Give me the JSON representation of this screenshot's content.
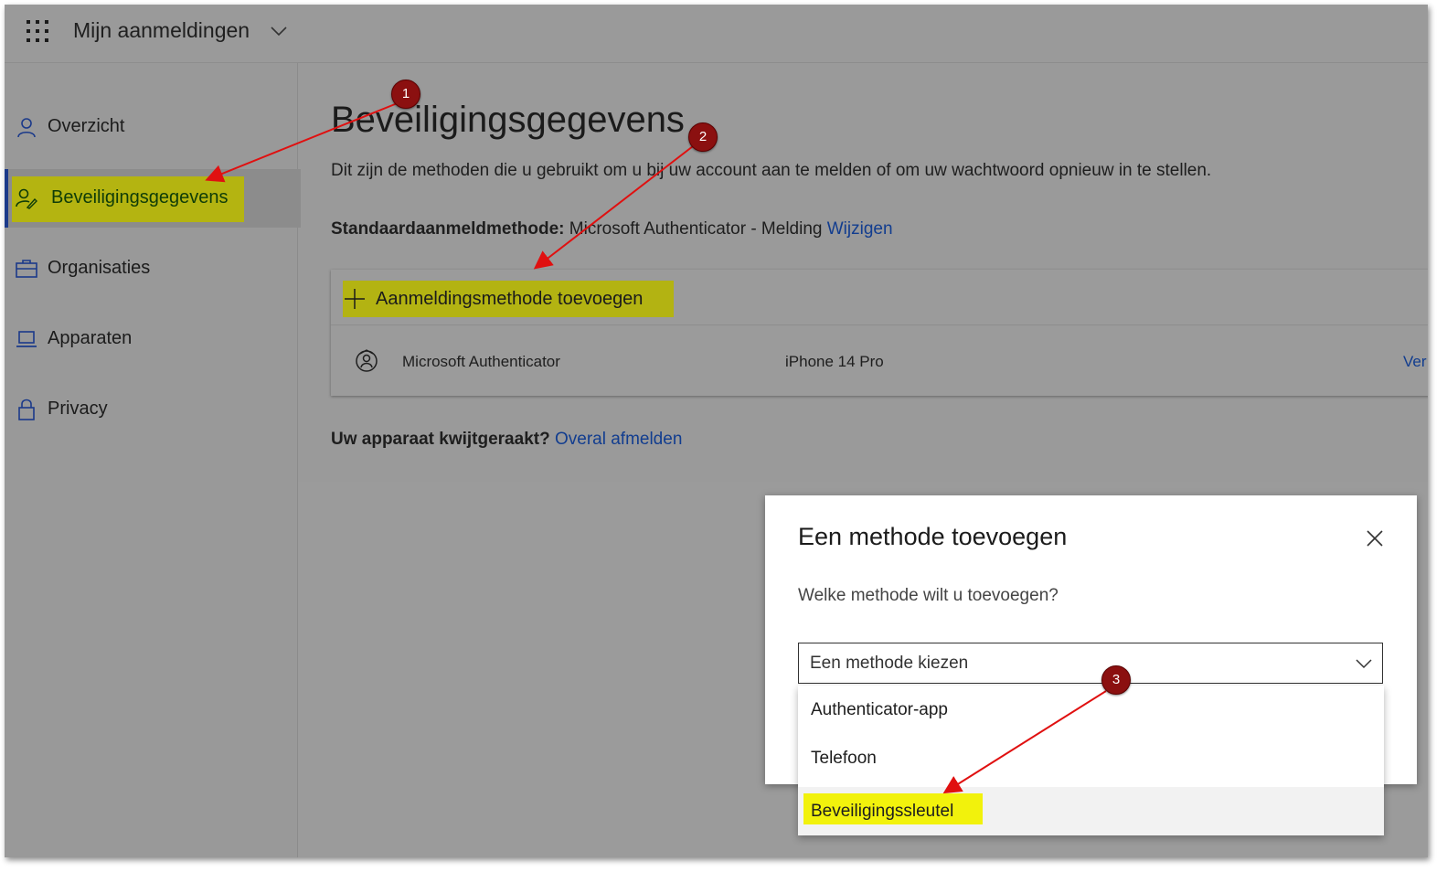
{
  "topbar": {
    "title": "Mijn aanmeldingen"
  },
  "sidebar": {
    "items": [
      {
        "label": "Overzicht",
        "icon": "person-icon"
      },
      {
        "label": "Beveiligingsgegevens",
        "icon": "security-info-icon",
        "active": true
      },
      {
        "label": "Organisaties",
        "icon": "briefcase-icon"
      },
      {
        "label": "Apparaten",
        "icon": "laptop-icon"
      },
      {
        "label": "Privacy",
        "icon": "lock-icon"
      }
    ]
  },
  "main": {
    "title": "Beveiligingsgegevens",
    "description": "Dit zijn de methoden die u gebruikt om u bij uw account aan te melden of om uw wachtwoord opnieuw in te stellen.",
    "default_method": {
      "label": "Standaardaanmeldmethode:",
      "value": "Microsoft Authenticator - Melding",
      "change_link": "Wijzigen"
    },
    "add_method_label": "Aanmeldingsmethode toevoegen",
    "methods": [
      {
        "name": "Microsoft Authenticator",
        "device": "iPhone 14 Pro",
        "action": "Ver"
      }
    ],
    "lost_device": {
      "label": "Uw apparaat kwijtgeraakt?",
      "link": "Overal afmelden"
    }
  },
  "dialog": {
    "title": "Een methode toevoegen",
    "question": "Welke methode wilt u toevoegen?",
    "select_placeholder": "Een methode kiezen",
    "options": [
      "Authenticator-app",
      "Telefoon",
      "Beveiligingssleutel"
    ],
    "highlighted_option": "Beveiligingssleutel"
  },
  "annotations": {
    "badges": [
      "1",
      "2",
      "3"
    ],
    "color": "#e01010"
  }
}
